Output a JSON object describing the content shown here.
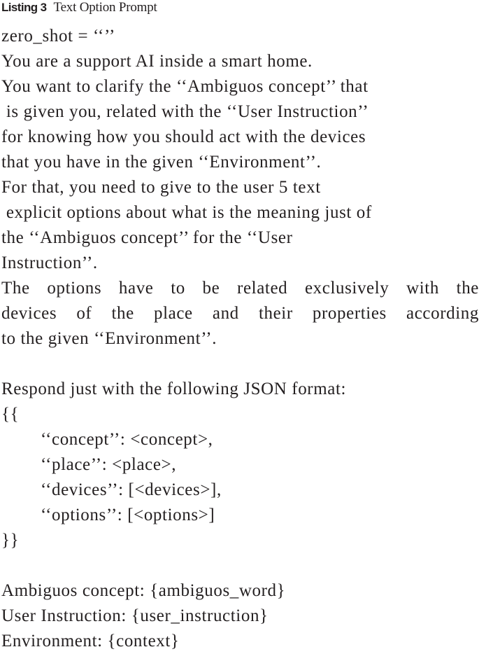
{
  "caption": {
    "label": "Listing 3",
    "title": "Text Option Prompt"
  },
  "listing": {
    "lines": [
      "zero_shot = ‘‘’’",
      "You are a support AI inside a smart home.",
      "You want to clarify the ‘‘Ambiguos concept’’ that",
      " is given you, related with the ‘‘User Instruction’’",
      "for knowing how you should act with the devices",
      "that you have in the given ‘‘Environment’’.",
      "For that, you need to give to the user 5 text",
      " explicit options about what is the meaning just of",
      "the ‘‘Ambiguos concept’’ for the ‘‘User",
      "Instruction’’.",
      "The options have to be related exclusively with the",
      "devices of the place and their properties according",
      "to the given ‘‘Environment’’.",
      "",
      "Respond just with the following JSON format:",
      "{{",
      "‘‘concept’’: <concept>,",
      "‘‘place’’: <place>,",
      "‘‘devices’’: [<devices>],",
      "‘‘options’’: [<options>]",
      "}}",
      "",
      "Ambiguos concept: {ambiguos_word}",
      "User Instruction: {user_instruction}",
      "Environment: {context}"
    ]
  }
}
